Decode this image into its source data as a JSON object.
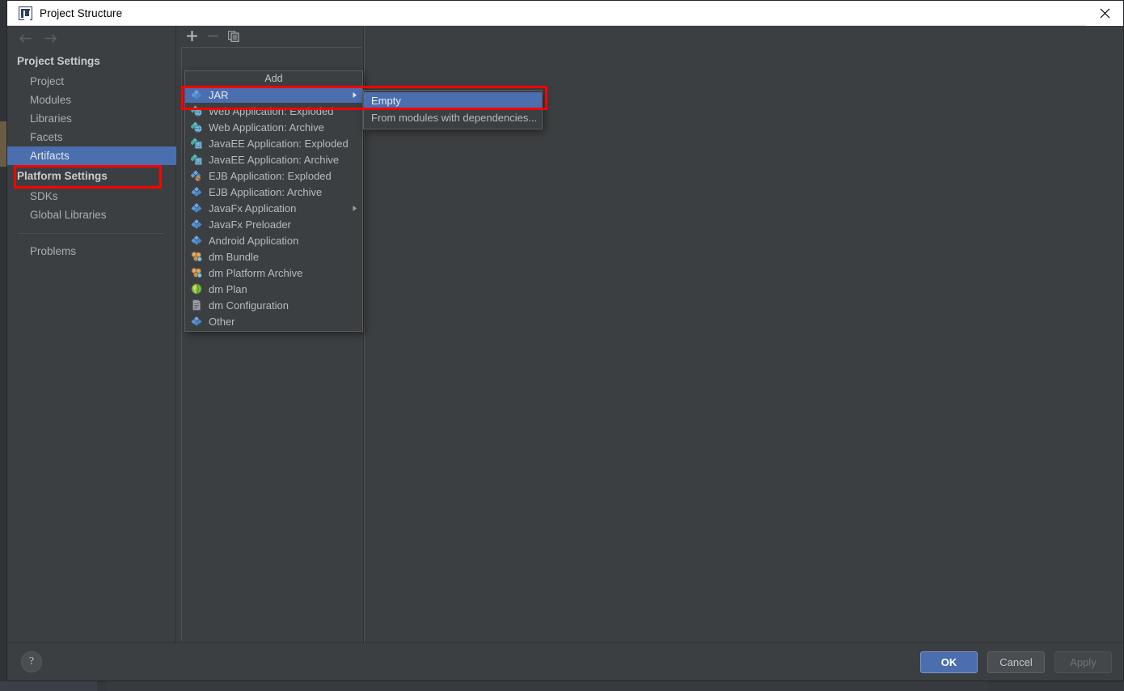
{
  "window": {
    "title": "Project Structure",
    "app_icon": "intellij-idea-icon",
    "close_icon": "close-icon"
  },
  "sidebar": {
    "nav": {
      "back_icon": "arrow-left-icon",
      "forward_icon": "arrow-right-icon"
    },
    "groups": [
      {
        "title": "Project Settings",
        "items": [
          {
            "label": "Project",
            "selected": false
          },
          {
            "label": "Modules",
            "selected": false
          },
          {
            "label": "Libraries",
            "selected": false
          },
          {
            "label": "Facets",
            "selected": false
          },
          {
            "label": "Artifacts",
            "selected": true
          }
        ]
      },
      {
        "title": "Platform Settings",
        "items": [
          {
            "label": "SDKs",
            "selected": false
          },
          {
            "label": "Global Libraries",
            "selected": false
          }
        ]
      }
    ],
    "problems": {
      "label": "Problems"
    }
  },
  "artifacts_panel": {
    "toolbar": [
      {
        "name": "add-button",
        "icon": "plus-icon",
        "enabled": true
      },
      {
        "name": "remove-button",
        "icon": "minus-icon",
        "enabled": false
      },
      {
        "name": "copy-button",
        "icon": "copy-icon",
        "enabled": true
      }
    ]
  },
  "add_popup": {
    "header": "Add",
    "items": [
      {
        "label": "JAR",
        "icon": "jar-artifact-icon",
        "icon_kind": "diamond-blue",
        "has_submenu": true,
        "selected": true
      },
      {
        "label": "Web Application: Exploded",
        "icon": "web-application-exploded-icon",
        "icon_kind": "diamond-teal-globe",
        "has_submenu": false,
        "selected": false
      },
      {
        "label": "Web Application: Archive",
        "icon": "web-application-archive-icon",
        "icon_kind": "diamond-teal-globe",
        "has_submenu": false,
        "selected": false
      },
      {
        "label": "JavaEE Application: Exploded",
        "icon": "javaee-application-exploded-icon",
        "icon_kind": "diamond-teal-building",
        "has_submenu": false,
        "selected": false
      },
      {
        "label": "JavaEE Application: Archive",
        "icon": "javaee-application-archive-icon",
        "icon_kind": "diamond-teal-building",
        "has_submenu": false,
        "selected": false
      },
      {
        "label": "EJB Application: Exploded",
        "icon": "ejb-application-exploded-icon",
        "icon_kind": "diamond-blue-brown",
        "has_submenu": false,
        "selected": false
      },
      {
        "label": "EJB Application: Archive",
        "icon": "ejb-application-archive-icon",
        "icon_kind": "diamond-blue",
        "has_submenu": false,
        "selected": false
      },
      {
        "label": "JavaFx Application",
        "icon": "javafx-application-icon",
        "icon_kind": "diamond-blue",
        "has_submenu": true,
        "selected": false
      },
      {
        "label": "JavaFx Preloader",
        "icon": "javafx-preloader-icon",
        "icon_kind": "diamond-blue",
        "has_submenu": false,
        "selected": false
      },
      {
        "label": "Android Application",
        "icon": "android-application-icon",
        "icon_kind": "diamond-blue",
        "has_submenu": false,
        "selected": false
      },
      {
        "label": "dm Bundle",
        "icon": "dm-bundle-icon",
        "icon_kind": "tan-cluster",
        "has_submenu": false,
        "selected": false
      },
      {
        "label": "dm Platform Archive",
        "icon": "dm-platform-archive-icon",
        "icon_kind": "tan-cluster",
        "has_submenu": false,
        "selected": false
      },
      {
        "label": "dm Plan",
        "icon": "dm-plan-icon",
        "icon_kind": "green-globe",
        "has_submenu": false,
        "selected": false
      },
      {
        "label": "dm Configuration",
        "icon": "dm-configuration-icon",
        "icon_kind": "gray-document",
        "has_submenu": false,
        "selected": false
      },
      {
        "label": "Other",
        "icon": "other-artifact-icon",
        "icon_kind": "diamond-blue",
        "has_submenu": false,
        "selected": false
      }
    ]
  },
  "jar_submenu": {
    "items": [
      {
        "label": "Empty",
        "selected": true
      },
      {
        "label": "From modules with dependencies...",
        "selected": false
      }
    ]
  },
  "bottom_bar": {
    "help_label": "?",
    "buttons": [
      {
        "label": "OK",
        "style": "primary"
      },
      {
        "label": "Cancel",
        "style": "normal"
      },
      {
        "label": "Apply",
        "style": "disabled"
      }
    ]
  },
  "annotations": {
    "accent_color": "#ff0000",
    "selection_color": "#4b6eaf",
    "highlighted": [
      "Artifacts",
      "JAR",
      "Empty"
    ]
  }
}
